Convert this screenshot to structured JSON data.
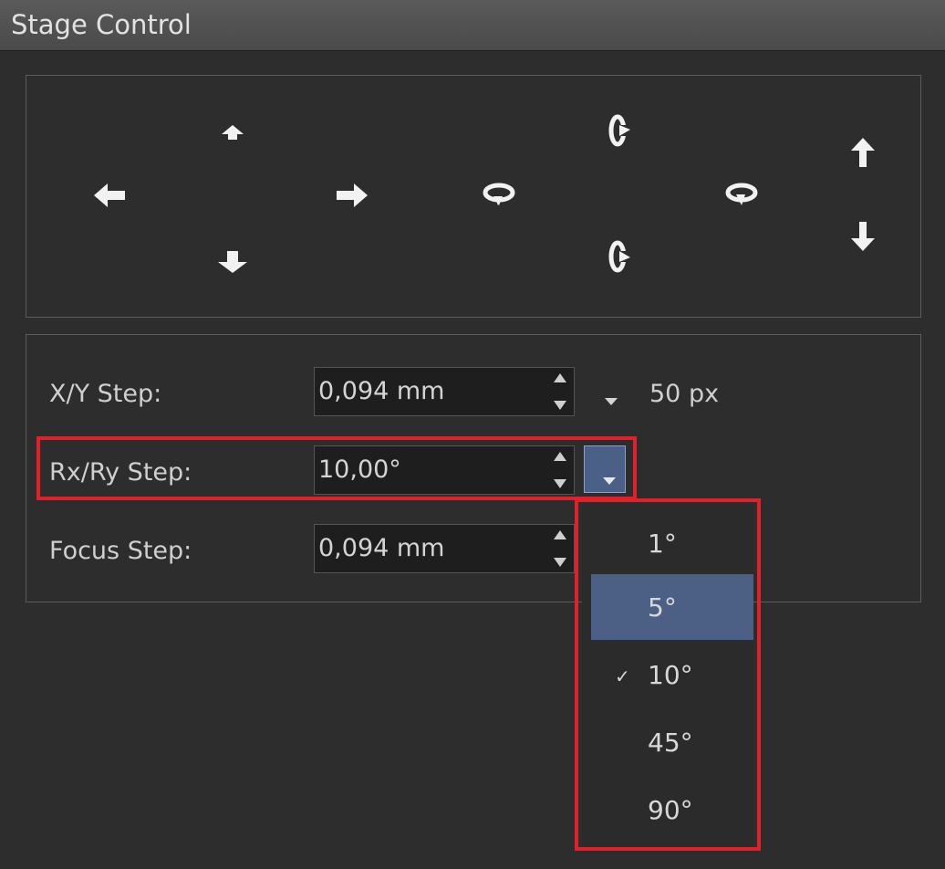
{
  "window": {
    "title": "Stage Control"
  },
  "navigation": {
    "icons": [
      "arrow-up-small-icon",
      "arrow-left-icon",
      "arrow-right-icon",
      "arrow-down-icon",
      "rotate-cw-horizontal-icon",
      "rotate-up-icon",
      "rotate-down-icon",
      "rotate-ccw-horizontal-icon",
      "focus-up-icon",
      "focus-down-icon"
    ]
  },
  "steps": {
    "xy": {
      "label": "X/Y Step:",
      "value": "0,094 mm",
      "unit_value": "50 px"
    },
    "rxry": {
      "label": "Rx/Ry Step:",
      "value": "10,00°"
    },
    "focus": {
      "label": "Focus Step:",
      "value": "0,094 mm"
    }
  },
  "dropdown": {
    "options": [
      "1°",
      "5°",
      "10°",
      "45°",
      "90°"
    ],
    "hovered": "5°",
    "checked": "10°",
    "check_mark": "✓"
  },
  "colors": {
    "highlight": "#e0202a",
    "selection": "#4c6085",
    "background": "#2d2d2d"
  }
}
